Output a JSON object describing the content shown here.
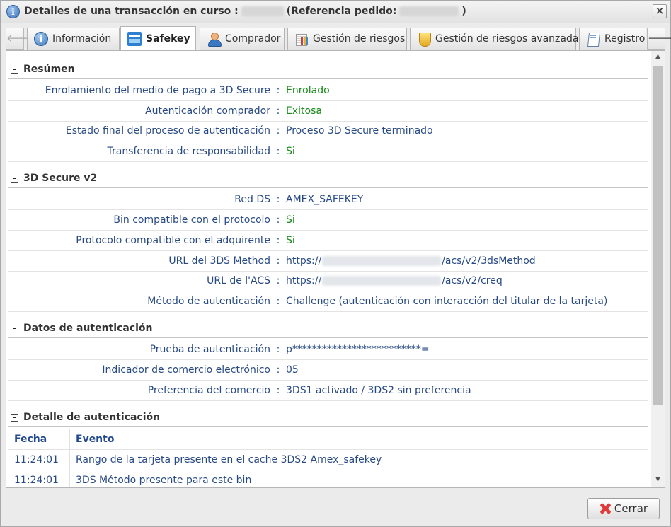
{
  "window": {
    "title_prefix": "Detalles de una transacción en curso :",
    "title_ref": "(Referencia pedido:",
    "title_suffix": ")"
  },
  "tabs": [
    {
      "label": "Información",
      "icon": "info-icon"
    },
    {
      "label": "Safekey",
      "icon": "amex-card-icon",
      "active": true
    },
    {
      "label": "Comprador",
      "icon": "user-icon"
    },
    {
      "label": "Gestión de riesgos",
      "icon": "chart-icon"
    },
    {
      "label": "Gestión de riesgos avanzada",
      "icon": "shield-icon"
    },
    {
      "label": "Registro de",
      "icon": "document-icon"
    }
  ],
  "sections": {
    "resumen": {
      "title": "Resúmen",
      "rows": [
        {
          "label": "Enrolamiento del medio de pago a 3D Secure",
          "value": "Enrolado"
        },
        {
          "label": "Autenticación comprador",
          "value": "Exitosa"
        },
        {
          "label": "Estado final del proceso de autenticación",
          "value": "Proceso 3D Secure terminado"
        },
        {
          "label": "Transferencia de responsabilidad",
          "value": "Si"
        }
      ]
    },
    "v2": {
      "title": "3D Secure v2",
      "rows": [
        {
          "label": "Red DS",
          "value": "AMEX_SAFEKEY"
        },
        {
          "label": "Bin compatible con el protocolo",
          "value": "Si"
        },
        {
          "label": "Protocolo compatible con el adquirente",
          "value": "Si"
        },
        {
          "label": "URL del 3DS Method",
          "value_prefix": "https://",
          "value_suffix": "/acs/v2/3dsMethod"
        },
        {
          "label": "URL de l'ACS",
          "value_prefix": "https://",
          "value_suffix": "/acs/v2/creq"
        },
        {
          "label": "Método de autenticación",
          "value": "Challenge (autenticación con interacción del titular de la tarjeta)"
        }
      ]
    },
    "auth_data": {
      "title": "Datos de autenticación",
      "rows": [
        {
          "label": "Prueba de autenticación",
          "value": "p**************************="
        },
        {
          "label": "Indicador de comercio electrónico",
          "value": "05"
        },
        {
          "label": "Preferencia del comercio",
          "value": "3DS1 activado / 3DS2 sin preferencia"
        }
      ]
    },
    "auth_detail": {
      "title": "Detalle de autenticación",
      "columns": [
        "Fecha",
        "Evento"
      ],
      "rows": [
        [
          "11:24:01",
          "Rango de la tarjeta presente en el cache 3DS2 Amex_safekey"
        ],
        [
          "11:24:01",
          "3DS Método presente para este bin"
        ]
      ]
    }
  },
  "row_separator": ":",
  "footer": {
    "close_label": "Cerrar"
  },
  "colors": {
    "label_blue": "#284a83",
    "value_green": "#1b8a1b",
    "header_blue": "#234a8e",
    "close_red": "#e03a3a"
  }
}
